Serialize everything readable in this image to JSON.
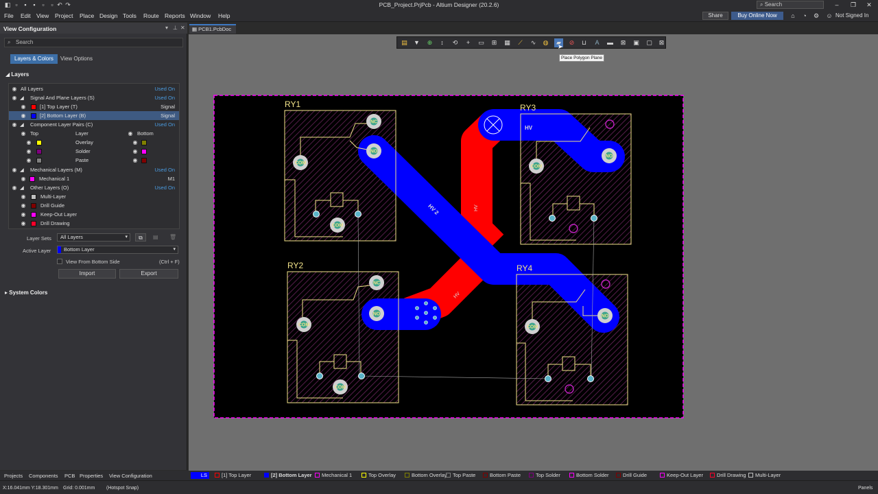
{
  "titlebar": {
    "title": "PCB_Project.PrjPcb - Altium Designer (20.2.6)",
    "search_placeholder": "Search"
  },
  "menubar": {
    "items": [
      "File",
      "Edit",
      "View",
      "Project",
      "Place",
      "Design",
      "Tools",
      "Route",
      "Reports",
      "Window",
      "Help"
    ],
    "share": "Share",
    "buy": "Buy Online Now",
    "signin": "Not Signed In"
  },
  "panel": {
    "title": "View Configuration",
    "search_placeholder": "Search",
    "tabs": [
      "Layers & Colors",
      "View Options"
    ],
    "layers_heading": "Layers",
    "rows": [
      {
        "label": "All Layers",
        "right": "Used On"
      },
      {
        "label": "Signal And Plane Layers (S)",
        "right": "Used On"
      },
      {
        "label": "[1] Top Layer (T)",
        "right": "Signal",
        "color": "#ff0000"
      },
      {
        "label": "[2] Bottom Layer (B)",
        "right": "Signal",
        "color": "#0000ff"
      },
      {
        "label": "Component Layer Pairs (C)",
        "right": "Used On"
      },
      {
        "label": "Top",
        "mid": "Layer",
        "right": "Bottom"
      },
      {
        "label": "Overlay",
        "color": "#ffff00",
        "color2": "#808000"
      },
      {
        "label": "Solder",
        "color": "#800080",
        "color2": "#ff00ff"
      },
      {
        "label": "Paste",
        "color": "#808080",
        "color2": "#800000"
      },
      {
        "label": "Mechanical Layers (M)",
        "right": "Used On"
      },
      {
        "label": "Mechanical 1",
        "right": "M1",
        "color": "#ff00ff"
      },
      {
        "label": "Other Layers (O)",
        "right": "Used On"
      },
      {
        "label": "Multi-Layer",
        "color": "#c0c0c0"
      },
      {
        "label": "Drill Guide",
        "color": "#800000"
      },
      {
        "label": "Keep-Out Layer",
        "color": "#ff00ff"
      },
      {
        "label": "Drill Drawing",
        "color": "#ff002a"
      }
    ],
    "layer_sets_label": "Layer Sets",
    "layer_sets_value": "All Layers",
    "active_layer_label": "Active Layer",
    "active_layer_value": "Bottom Layer",
    "view_bottom_label": "View From Bottom Side",
    "view_bottom_shortcut": "(Ctrl + F)",
    "import": "Import",
    "export": "Export",
    "system_colors": "System Colors"
  },
  "doc_tab": "PCB1.PcbDoc",
  "tooltip": "Place Polygon Plane",
  "pcb": {
    "designators": [
      "RY1",
      "RY2",
      "RY3",
      "RY4"
    ],
    "pad_labels": {
      "nc": "NC",
      "no": "NO",
      "com": "COM"
    },
    "track_labels": {
      "hv": "HV",
      "hv2": "HV 2"
    }
  },
  "bottom_tabs": [
    "Projects",
    "Components",
    "PCB",
    "Properties",
    "View Configuration"
  ],
  "layer_tabs": [
    {
      "label": "LS",
      "color": "#0000ff"
    },
    {
      "label": "[1] Top Layer",
      "color": "#ff0000"
    },
    {
      "label": "[2] Bottom Layer",
      "color": "#0000ff"
    },
    {
      "label": "Mechanical 1",
      "color": "#ff00ff"
    },
    {
      "label": "Top Overlay",
      "color": "#ffff00"
    },
    {
      "label": "Bottom Overlay",
      "color": "#808000"
    },
    {
      "label": "Top Paste",
      "color": "#808080"
    },
    {
      "label": "Bottom Paste",
      "color": "#800000"
    },
    {
      "label": "Top Solder",
      "color": "#800080"
    },
    {
      "label": "Bottom Solder",
      "color": "#ff00ff"
    },
    {
      "label": "Drill Guide",
      "color": "#800000"
    },
    {
      "label": "Keep-Out Layer",
      "color": "#ff00ff"
    },
    {
      "label": "Drill Drawing",
      "color": "#ff002a"
    },
    {
      "label": "Multi-Layer",
      "color": "#c0c0c0"
    }
  ],
  "status": {
    "coords": "X:16.041mm Y:18.301mm",
    "grid": "Grid: 0.001mm",
    "snap": "(Hotspot Snap)",
    "panels": "Panels"
  }
}
